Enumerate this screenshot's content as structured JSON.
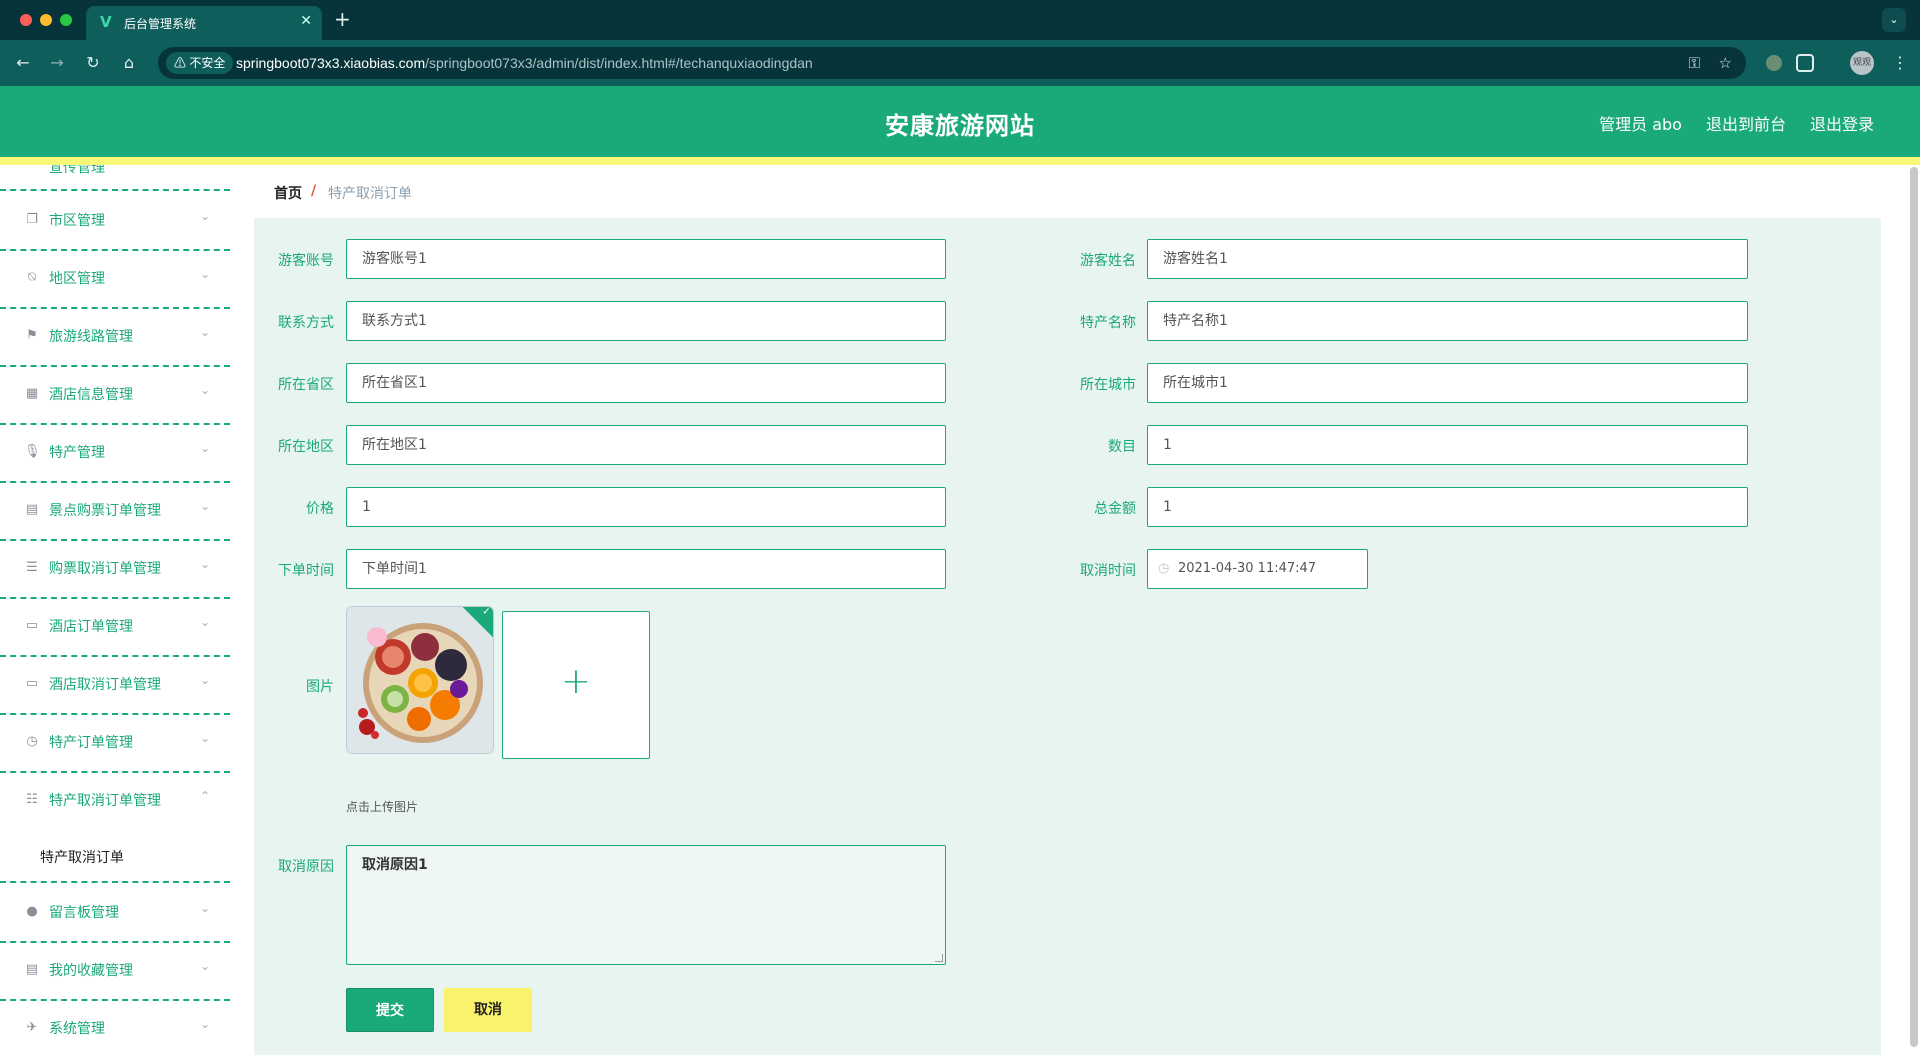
{
  "browser": {
    "tab_title": "后台管理系统",
    "security_label": "不安全",
    "url_host": "springboot073x3.xiaobias.com",
    "url_path": "/springboot073x3/admin/dist/index.html#/techanquxiaodingdan",
    "profile_label": "观观"
  },
  "header": {
    "site_title": "安康旅游网站",
    "admin_label": "管理员 abo",
    "back_to_front": "退出到前台",
    "logout": "退出登录"
  },
  "sidebar": {
    "cut_item": "宣传管理",
    "items": [
      {
        "label": "市区管理",
        "icon": "copy-icon"
      },
      {
        "label": "地区管理",
        "icon": "bell-off-icon"
      },
      {
        "label": "旅游线路管理",
        "icon": "flag-icon"
      },
      {
        "label": "酒店信息管理",
        "icon": "grid-icon"
      },
      {
        "label": "特产管理",
        "icon": "microphone-icon"
      },
      {
        "label": "景点购票订单管理",
        "icon": "clipboard-icon"
      },
      {
        "label": "购票取消订单管理",
        "icon": "list-icon"
      },
      {
        "label": "酒店订单管理",
        "icon": "monitor-icon"
      },
      {
        "label": "酒店取消订单管理",
        "icon": "monitor-icon"
      },
      {
        "label": "特产订单管理",
        "icon": "clock-icon"
      },
      {
        "label": "特产取消订单管理",
        "icon": "sliders-icon"
      }
    ],
    "sub_item": "特产取消订单",
    "items_after": [
      {
        "label": "留言板管理",
        "icon": "balloon-icon"
      },
      {
        "label": "我的收藏管理",
        "icon": "clipboard-icon"
      },
      {
        "label": "系统管理",
        "icon": "ticket-icon"
      }
    ]
  },
  "breadcrumb": {
    "home": "首页",
    "separator": "/",
    "current": "特产取消订单"
  },
  "form": {
    "youke_zhanghao": {
      "label": "游客账号",
      "value": "游客账号1"
    },
    "youke_xingming": {
      "label": "游客姓名",
      "value": "游客姓名1"
    },
    "lianxi_fangshi": {
      "label": "联系方式",
      "value": "联系方式1"
    },
    "techan_mingcheng": {
      "label": "特产名称",
      "value": "特产名称1"
    },
    "suozai_shengqu": {
      "label": "所在省区",
      "value": "所在省区1"
    },
    "suozai_chengshi": {
      "label": "所在城市",
      "value": "所在城市1"
    },
    "suozai_diqu": {
      "label": "所在地区",
      "value": "所在地区1"
    },
    "shumu": {
      "label": "数目",
      "value": "1"
    },
    "jiage": {
      "label": "价格",
      "value": "1"
    },
    "zongjine": {
      "label": "总金额",
      "value": "1"
    },
    "xiadan_shijian": {
      "label": "下单时间",
      "value": "下单时间1"
    },
    "quxiao_shijian": {
      "label": "取消时间",
      "value": "2021-04-30 11:47:47"
    },
    "tupian": {
      "label": "图片",
      "upload_tip": "点击上传图片"
    },
    "quxiao_yuanyin": {
      "label": "取消原因",
      "value": "取消原因1"
    },
    "submit_label": "提交",
    "cancel_label": "取消"
  },
  "colors": {
    "primary": "#1aa97a",
    "accent_yellow": "#f8f36a",
    "panel_bg": "#e8f4ef"
  }
}
